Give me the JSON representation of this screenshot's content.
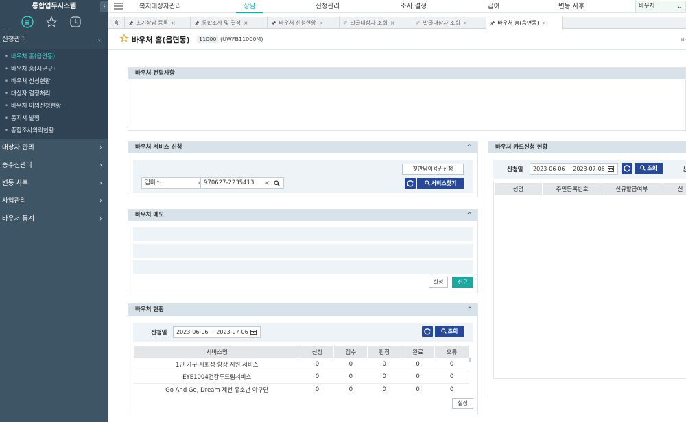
{
  "sidebar": {
    "title": "통합업무시스템",
    "collapse": "‹",
    "plus_minus": "+ −",
    "open_menu": {
      "label": "신청관리",
      "chevron": "⌄"
    },
    "sub_items": [
      {
        "label": "바우처 홈(읍면동)",
        "active": true
      },
      {
        "label": "바우처 홈(시군구)"
      },
      {
        "label": "바우처 신청현황"
      },
      {
        "label": "대상자 결정처리"
      },
      {
        "label": "바우처 이의신청현황"
      },
      {
        "label": "통지서 발행"
      },
      {
        "label": "종합조사의뢰현황"
      }
    ],
    "menus": [
      {
        "label": "대상자 관리",
        "chevron": "›"
      },
      {
        "label": "송수신관리",
        "chevron": "›"
      },
      {
        "label": "변동 사후",
        "chevron": "›"
      },
      {
        "label": "사업관리",
        "chevron": "›"
      },
      {
        "label": "바우처 통계",
        "chevron": "›"
      }
    ]
  },
  "topnav": {
    "items": [
      "복지대상자관리",
      "상담",
      "신청관리",
      "조사.결정",
      "급여",
      "변동.사후"
    ],
    "active_index": 1,
    "select_value": "바우처",
    "select_caret": "⌄"
  },
  "tabs": {
    "home": "홈",
    "items": [
      {
        "label": "초기상담 등록",
        "pinned": true
      },
      {
        "label": "통합조사 및 결정",
        "pinned": true
      },
      {
        "label": "바우처 신청현황",
        "pinned": true
      },
      {
        "label": "발굴대상자 조회",
        "pinned": false
      },
      {
        "label": "발굴대상자 조회",
        "pinned": false
      },
      {
        "label": "바우처 홈(읍면동)",
        "pinned": true,
        "active": true
      }
    ],
    "close": "×"
  },
  "page": {
    "title": "바우처 홈(읍면동)",
    "code": "11000",
    "code_sub": "(UWFB11000M)",
    "right_letter": "바"
  },
  "notice_panel": {
    "title": "바우처 전달사항"
  },
  "service_panel": {
    "title": "바우처 서비스 신청",
    "toggle": "^",
    "name_value": "김미소",
    "rrn_value": "970627-2235413",
    "first_voucher_button": "첫만남이용권신청",
    "find_service_button": "서비스찾기"
  },
  "memo_panel": {
    "title": "바우처 메모",
    "toggle": "^",
    "settings_button": "설정",
    "new_button": "신규"
  },
  "status_panel": {
    "title": "바우처 현황",
    "toggle": "^",
    "date_label": "신청일",
    "date_range": "2023-06-06 ~ 2023-07-06",
    "search_button": "조회",
    "columns": [
      "서비스명",
      "신청",
      "접수",
      "판정",
      "완료",
      "오류"
    ],
    "rows": [
      [
        "1인 가구 사회성 향상 지원 서비스",
        "0",
        "0",
        "0",
        "0",
        "0"
      ],
      [
        "EYE1004건강두드림서비스",
        "0",
        "0",
        "0",
        "0",
        "0"
      ],
      [
        "Go And Go, Dream 제천 유소년 야구단",
        "0",
        "0",
        "0",
        "0",
        "0"
      ]
    ],
    "settings_button": "설정"
  },
  "card_panel": {
    "title": "바우처 카드신청 현황",
    "date_label": "신청일",
    "date_range": "2023-06-06 ~ 2023-07-06",
    "search_button": "조회",
    "right_cut": "신",
    "columns": [
      "성명",
      "주민등록번호",
      "신규발급여부",
      "신"
    ]
  },
  "colors": {
    "sidebar_bg": "#3e5566",
    "accent_teal": "#1aa8a0",
    "button_navy": "#26489a",
    "panel_header": "#d7e2ea"
  }
}
